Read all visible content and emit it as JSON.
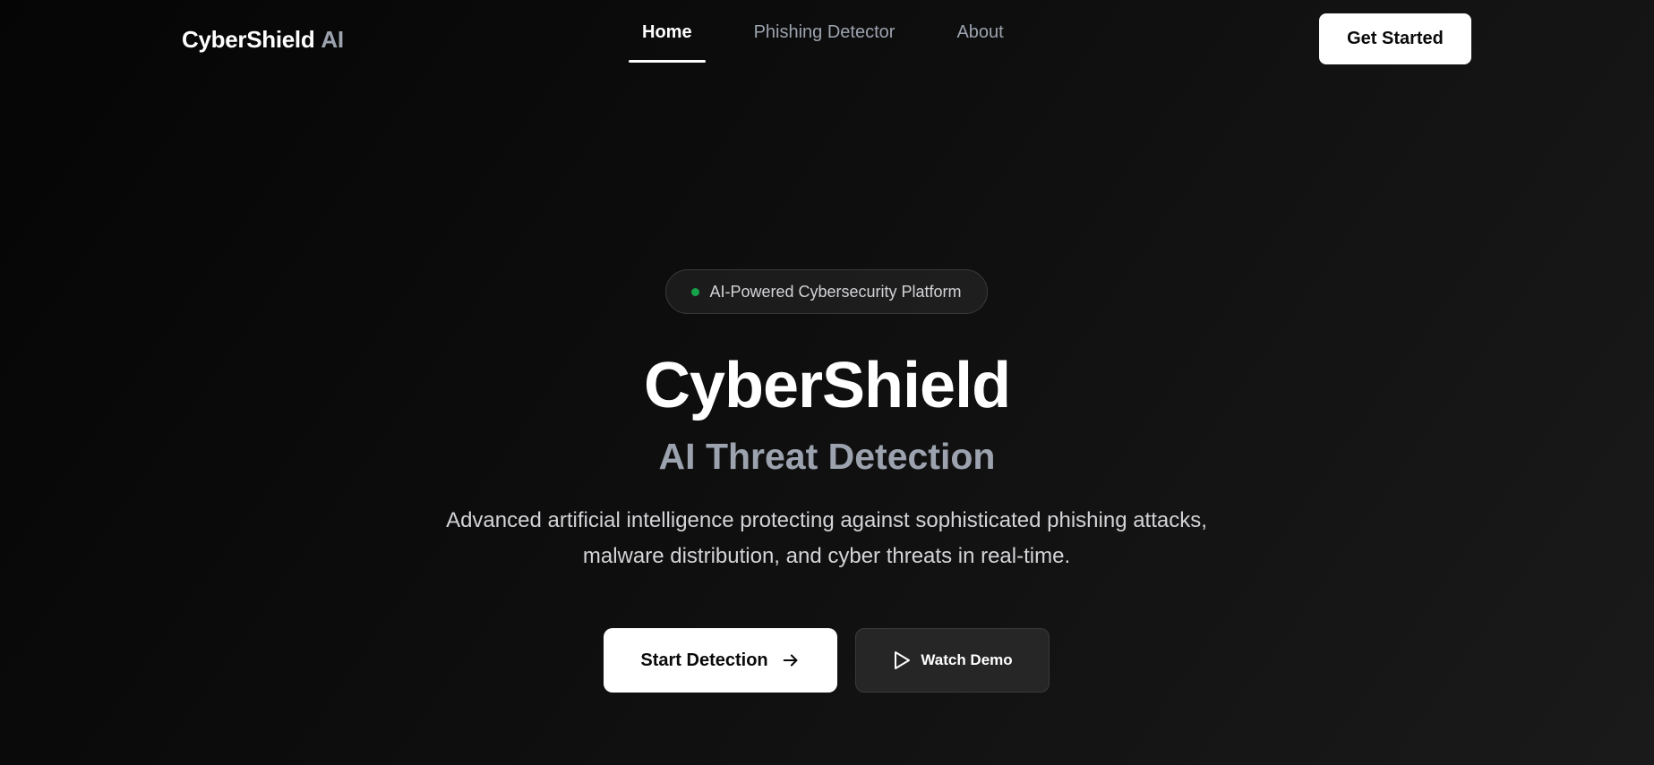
{
  "header": {
    "logo_main": "CyberShield",
    "logo_accent": "AI",
    "nav": [
      {
        "label": "Home",
        "active": true
      },
      {
        "label": "Phishing Detector",
        "active": false
      },
      {
        "label": "About",
        "active": false
      }
    ],
    "cta_label": "Get Started"
  },
  "hero": {
    "badge_text": "AI-Powered Cybersecurity Platform",
    "badge_dot_color": "#16a34a",
    "title": "CyberShield",
    "subtitle": "AI Threat Detection",
    "description": "Advanced artificial intelligence protecting against sophisticated phishing attacks, malware distribution, and cyber threats in real-time.",
    "primary_button": {
      "label": "Start Detection",
      "icon": "arrow-right-icon"
    },
    "secondary_button": {
      "label": "Watch Demo",
      "icon": "play-icon"
    }
  },
  "colors": {
    "background": "#0a0a0a",
    "text_primary": "#ffffff",
    "text_muted": "#9ca3af",
    "button_light": "#ffffff",
    "button_dark": "#262626"
  }
}
